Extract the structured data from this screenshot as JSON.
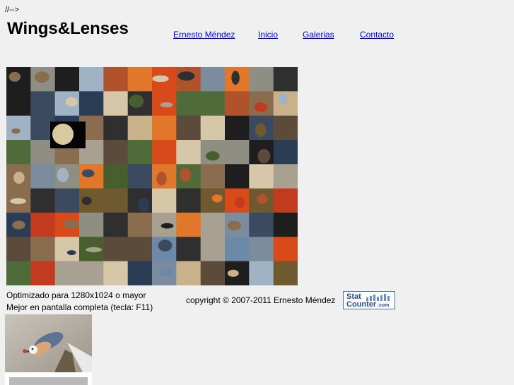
{
  "page": {
    "comment_text": "//-->",
    "site_title": "Wings&Lenses"
  },
  "nav": {
    "items": [
      {
        "label": "Ernesto Méndez"
      },
      {
        "label": "Inicio"
      },
      {
        "label": "Galerias"
      },
      {
        "label": "Contacto"
      }
    ]
  },
  "footer": {
    "optimized": "Optimizado para 1280x1024 o mayor",
    "fullscreen": "Mejor en pantalla completa (tecla: F11)",
    "copyright": "copyright © 2007-2011 Ernesto Méndez"
  },
  "statcounter": {
    "line1": "Stat",
    "line2": "Counter",
    "domain": ".com"
  },
  "colors": {
    "background": "#f0f0f0",
    "link": "#0000ee"
  }
}
